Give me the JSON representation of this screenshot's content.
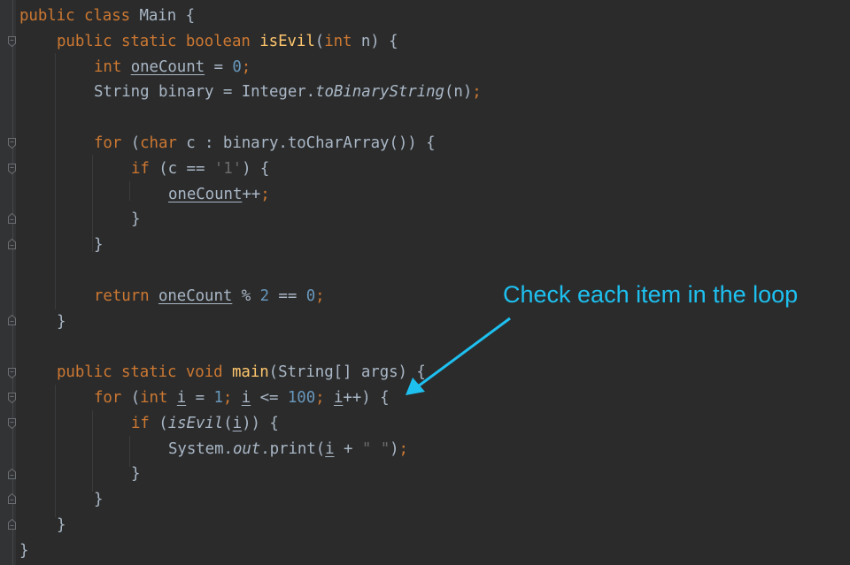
{
  "editor": {
    "theme": "darcula",
    "colors": {
      "background": "#2b2b2b",
      "gutter": "#313335",
      "keyword": "#cc7832",
      "number": "#6897bb",
      "method_decl": "#ffc66d",
      "default_text": "#a9b7c6",
      "annotation": "#1ec0f0"
    },
    "lines": {
      "l1": {
        "kw1": "public class ",
        "rest": "Main {"
      },
      "l2": {
        "kw1": "public static boolean ",
        "fn": "isEvil",
        "p1": "(",
        "kw2": "int",
        "p2": " n) {"
      },
      "l3": {
        "kw1": "int ",
        "var": "oneCount",
        "p1": " = ",
        "num": "0",
        "semi": ";"
      },
      "l4": {
        "p1": "String binary = Integer.",
        "method": "toBinaryString",
        "p2": "(n)",
        "semi": ";"
      },
      "l6": {
        "kw1": "for ",
        "p1": "(",
        "kw2": "char",
        "p2": " c : binary.toCharArray()) {"
      },
      "l7": {
        "kw1": "if ",
        "p1": "(c == ",
        "str": "'1'",
        "p2": ") {"
      },
      "l8": {
        "var": "oneCount",
        "p1": "++",
        "semi": ";"
      },
      "l9": {
        "p1": "}"
      },
      "l10": {
        "p1": "}"
      },
      "l12": {
        "kw1": "return ",
        "var": "oneCount",
        "p1": " % ",
        "num1": "2",
        "p2": " == ",
        "num2": "0",
        "semi": ";"
      },
      "l13": {
        "p1": "}"
      },
      "l15": {
        "kw1": "public static void ",
        "fn": "main",
        "p1": "(String[] args) {"
      },
      "l16": {
        "kw1": "for ",
        "p1": "(",
        "kw2": "int",
        "sp": " ",
        "v1": "i",
        "p2": " = ",
        "num1": "1",
        "semi1": ";",
        "sp2": " ",
        "v2": "i",
        "p3": " <= ",
        "num2": "100",
        "semi2": ";",
        "sp3": " ",
        "v3": "i",
        "p4": "++) {"
      },
      "l17": {
        "kw1": "if ",
        "p1": "(",
        "method": "isEvil",
        "p2": "(",
        "v1": "i",
        "p3": ")) {"
      },
      "l18": {
        "p1": "System.",
        "field": "out",
        "p2": ".print(",
        "v1": "i",
        "p3": " + ",
        "str": "\" \"",
        "p4": ")",
        "semi": ";"
      },
      "l19": {
        "p1": "}"
      },
      "l20": {
        "p1": "}"
      },
      "l21": {
        "p1": "}"
      },
      "l22": {
        "p1": "}"
      }
    }
  },
  "annotation": {
    "text": "Check each item in the loop",
    "icon": "arrow-icon"
  }
}
